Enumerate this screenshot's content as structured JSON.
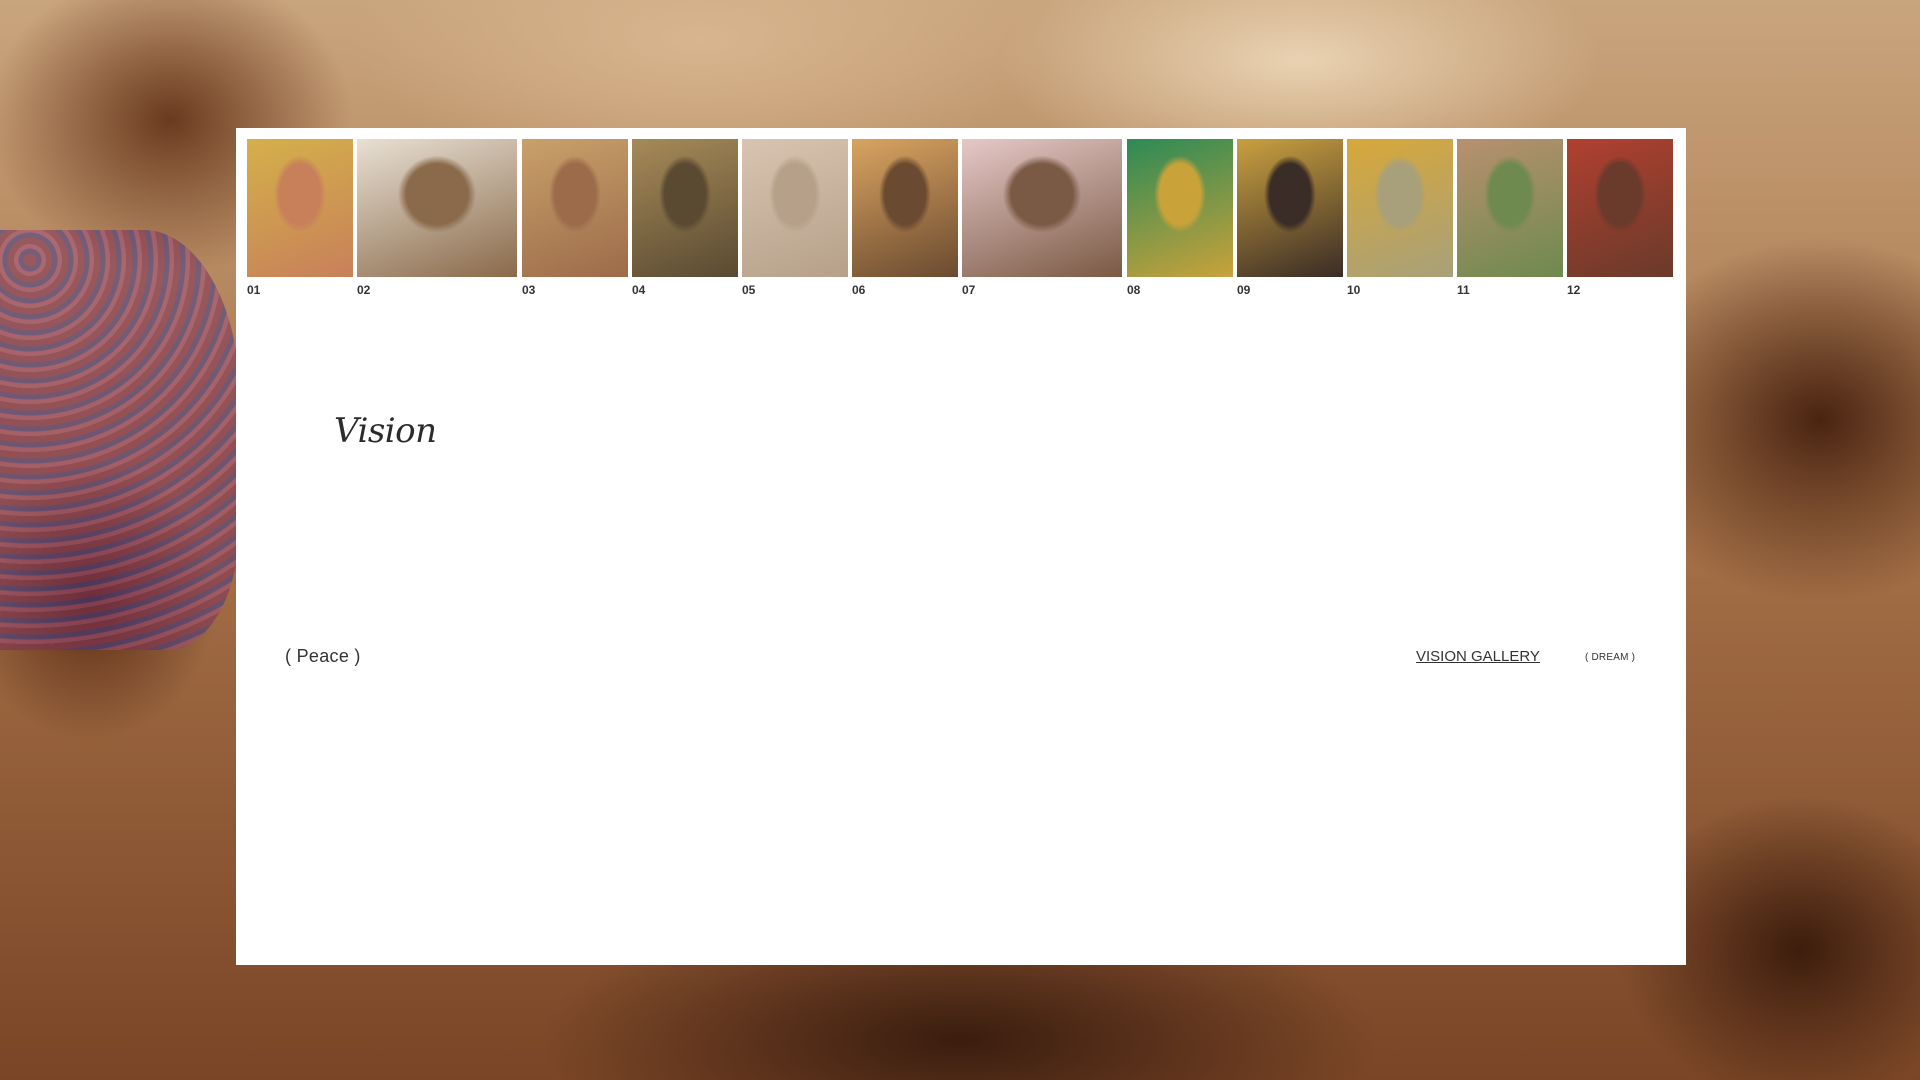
{
  "gallery": {
    "thumbnails": [
      {
        "number": "01",
        "color": "#c8805a",
        "accent": "#d4b04a"
      },
      {
        "number": "02",
        "color": "#8a6a4a",
        "accent": "#e8e0d4"
      },
      {
        "number": "03",
        "color": "#9c6b4a",
        "accent": "#c9a06a"
      },
      {
        "number": "04",
        "color": "#5a4a32",
        "accent": "#a68a58"
      },
      {
        "number": "05",
        "color": "#b6a08a",
        "accent": "#d8c4b0"
      },
      {
        "number": "06",
        "color": "#6a4a30",
        "accent": "#d9a461"
      },
      {
        "number": "07",
        "color": "#7a5a44",
        "accent": "#e6c8c8"
      },
      {
        "number": "08",
        "color": "#c9a23a",
        "accent": "#2c8a56"
      },
      {
        "number": "09",
        "color": "#3a2c26",
        "accent": "#c9a040"
      },
      {
        "number": "10",
        "color": "#a8a07a",
        "accent": "#d7a83a"
      },
      {
        "number": "11",
        "color": "#6e8a4e",
        "accent": "#b89070"
      },
      {
        "number": "12",
        "color": "#6a3a2a",
        "accent": "#b04030"
      }
    ]
  },
  "main": {
    "title": "Vision",
    "left_tag": "( Peace )",
    "gallery_link": "VISION GALLERY",
    "right_tag": "( DREAM )"
  }
}
